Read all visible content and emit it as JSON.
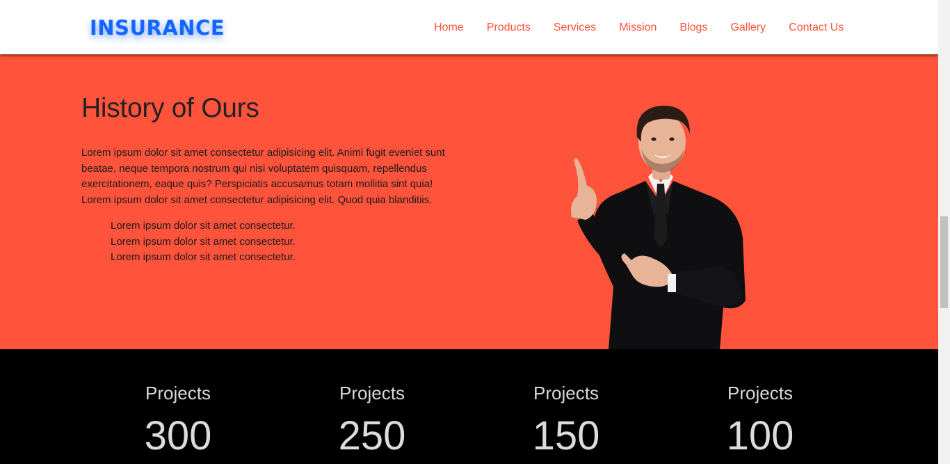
{
  "brand": {
    "name": "INSURANCE",
    "color": "#1565ff"
  },
  "nav": {
    "items": [
      "Home",
      "Products",
      "Services",
      "Mission",
      "Blogs",
      "Gallery",
      "Contact Us"
    ],
    "link_color": "#ff5138"
  },
  "hero": {
    "background": "#ff533c",
    "title": "History of Ours",
    "paragraph": "Lorem ipsum dolor sit amet consectetur adipisicing elit. Animi fugit eveniet sunt beatae, neque tempora nostrum qui nisi voluptatem quisquam, repellendus exercitationem, eaque quis? Perspiciatis accusamus totam mollitia sint quia! Lorem ipsum dolor sit amet consectetur adipisicing elit. Quod quia blanditiis.",
    "list": [
      "Lorem ipsum dolor sit amet consectetur.",
      "Lorem ipsum dolor sit amet consectetur.",
      "Lorem ipsum dolor sit amet consectetur."
    ]
  },
  "stats": [
    {
      "label": "Projects",
      "value": "300"
    },
    {
      "label": "Projects",
      "value": "250"
    },
    {
      "label": "Projects",
      "value": "150"
    },
    {
      "label": "Projects",
      "value": "100"
    }
  ]
}
